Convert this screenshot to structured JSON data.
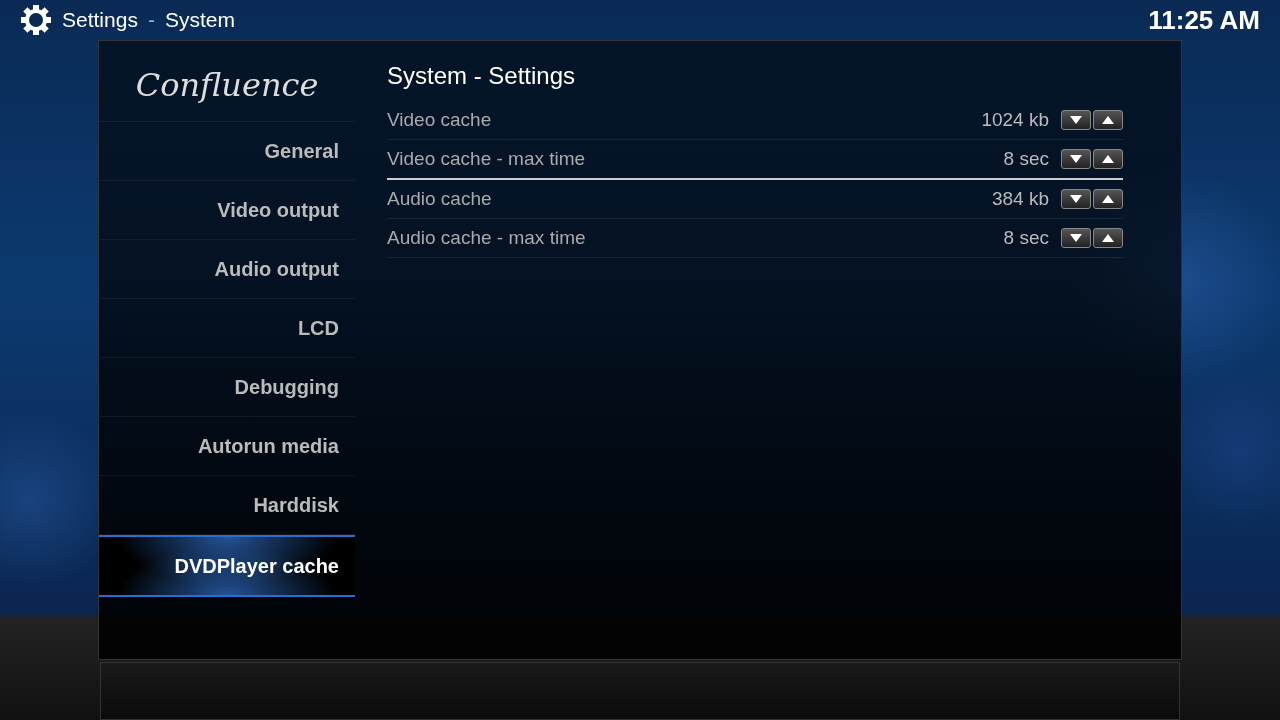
{
  "header": {
    "section": "Settings",
    "separator": "-",
    "subsection": "System",
    "clock": "11:25 AM"
  },
  "logo": "Confluence",
  "sidebar": {
    "items": [
      {
        "label": "General",
        "selected": false
      },
      {
        "label": "Video output",
        "selected": false
      },
      {
        "label": "Audio output",
        "selected": false
      },
      {
        "label": "LCD",
        "selected": false
      },
      {
        "label": "Debugging",
        "selected": false
      },
      {
        "label": "Autorun media",
        "selected": false
      },
      {
        "label": "Harddisk",
        "selected": false
      },
      {
        "label": "DVDPlayer cache",
        "selected": true
      }
    ]
  },
  "content": {
    "title": "System - Settings",
    "rows": [
      {
        "label": "Video cache",
        "value": "1024 kb",
        "selected": false
      },
      {
        "label": "Video cache - max time",
        "value": "8 sec",
        "selected": true
      },
      {
        "label": "Audio cache",
        "value": "384 kb",
        "selected": false
      },
      {
        "label": "Audio cache - max time",
        "value": "8 sec",
        "selected": false
      }
    ]
  }
}
